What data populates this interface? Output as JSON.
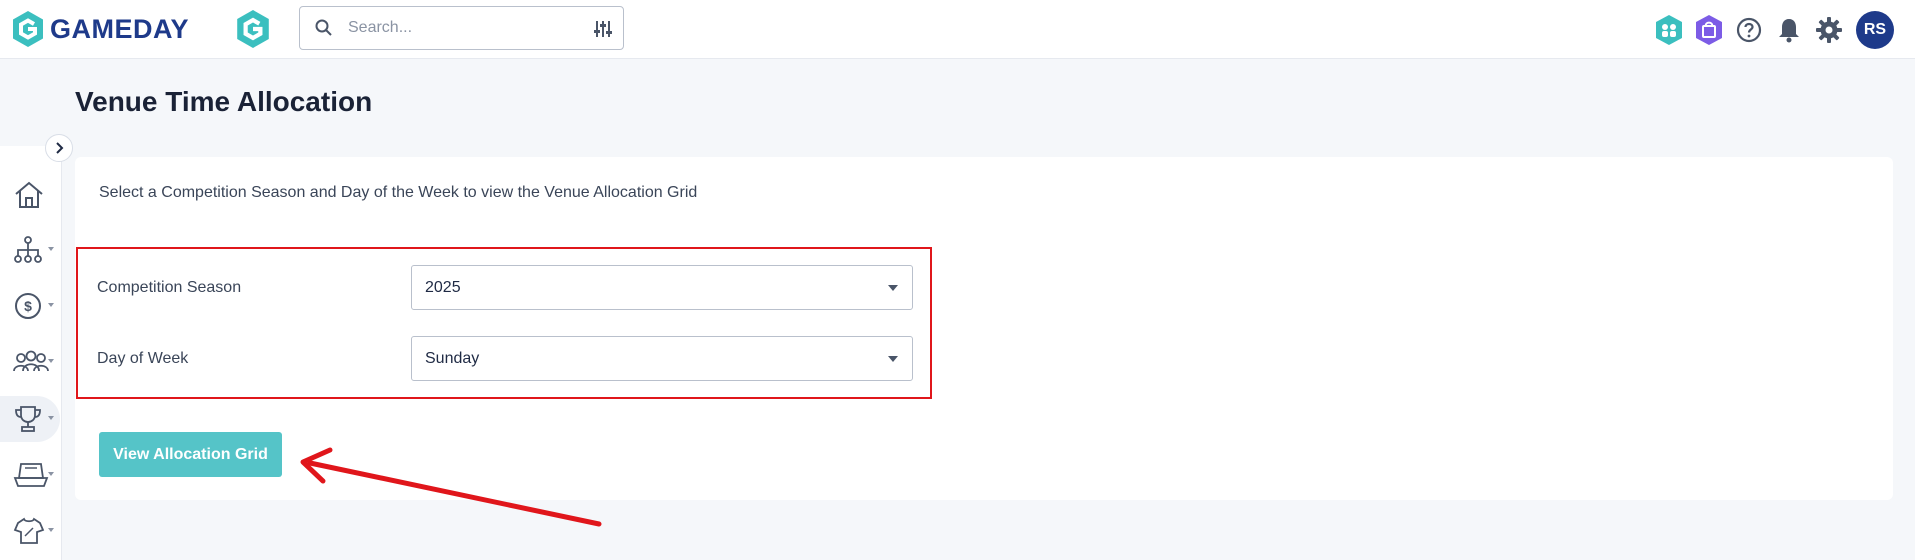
{
  "header": {
    "logo_text": "GAMEDAY",
    "search": {
      "placeholder": "Search..."
    },
    "avatar_initials": "RS"
  },
  "colors": {
    "brand_teal": "#3bbfbf",
    "brand_navy": "#1e3a8a",
    "button_teal": "#55c4c8",
    "highlight_red": "#e0161b"
  },
  "page": {
    "title": "Venue Time Allocation",
    "intro": "Select a Competition Season and Day of the Week to view the Venue Allocation Grid",
    "fields": [
      {
        "label": "Competition Season",
        "value": "2025"
      },
      {
        "label": "Day of Week",
        "value": "Sunday"
      }
    ],
    "submit_label": "View Allocation Grid"
  },
  "sidebar": {
    "items": [
      {
        "icon": "home-icon"
      },
      {
        "icon": "org-structure-icon"
      },
      {
        "icon": "finance-dollar-icon"
      },
      {
        "icon": "people-group-icon"
      },
      {
        "icon": "trophy-icon"
      },
      {
        "icon": "venue-icon"
      },
      {
        "icon": "jersey-icon"
      }
    ]
  }
}
